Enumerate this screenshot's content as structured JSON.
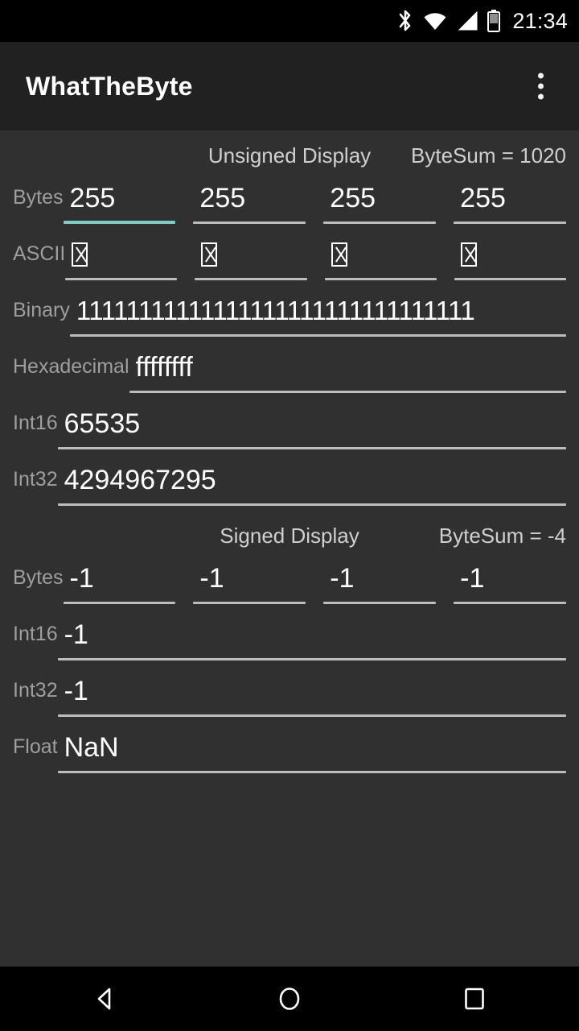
{
  "statusbar": {
    "time": "21:34",
    "icons": [
      "bluetooth-icon",
      "wifi-icon",
      "cell-signal-icon",
      "battery-icon"
    ]
  },
  "appbar": {
    "title": "WhatTheByte",
    "overflow_label": "More options"
  },
  "unsigned": {
    "header_center": "Unsigned Display",
    "header_right": "ByteSum = 1020",
    "rows": [
      {
        "label": "Bytes",
        "values": [
          "255",
          "255",
          "255",
          "255"
        ],
        "focused_index": 0
      },
      {
        "label": "ASCII",
        "values": [
          "�",
          "�",
          "�",
          "�"
        ],
        "glyph": "tofu"
      },
      {
        "label": "Binary",
        "values": [
          "11111111111111111111111111111111"
        ]
      },
      {
        "label": "Hexadecimal",
        "values": [
          "ffffffff"
        ]
      },
      {
        "label": "Int16",
        "values": [
          "65535"
        ]
      },
      {
        "label": "Int32",
        "values": [
          "4294967295"
        ]
      }
    ]
  },
  "signed": {
    "header_center": "Signed Display",
    "header_right": "ByteSum = -4",
    "rows": [
      {
        "label": "Bytes",
        "values": [
          "-1",
          "-1",
          "-1",
          "-1"
        ]
      },
      {
        "label": "Int16",
        "values": [
          "-1"
        ]
      },
      {
        "label": "Int32",
        "values": [
          "-1"
        ]
      },
      {
        "label": "Float",
        "values": [
          "NaN"
        ]
      }
    ]
  },
  "navbar": {
    "back": "back-button",
    "home": "home-button",
    "recents": "recents-button"
  },
  "colors": {
    "accent_underline": "#80cbc4",
    "underline": "#bdbdbd",
    "background": "#303030",
    "appbar": "#212121",
    "label": "#9e9e9e",
    "value": "#ffffff"
  }
}
